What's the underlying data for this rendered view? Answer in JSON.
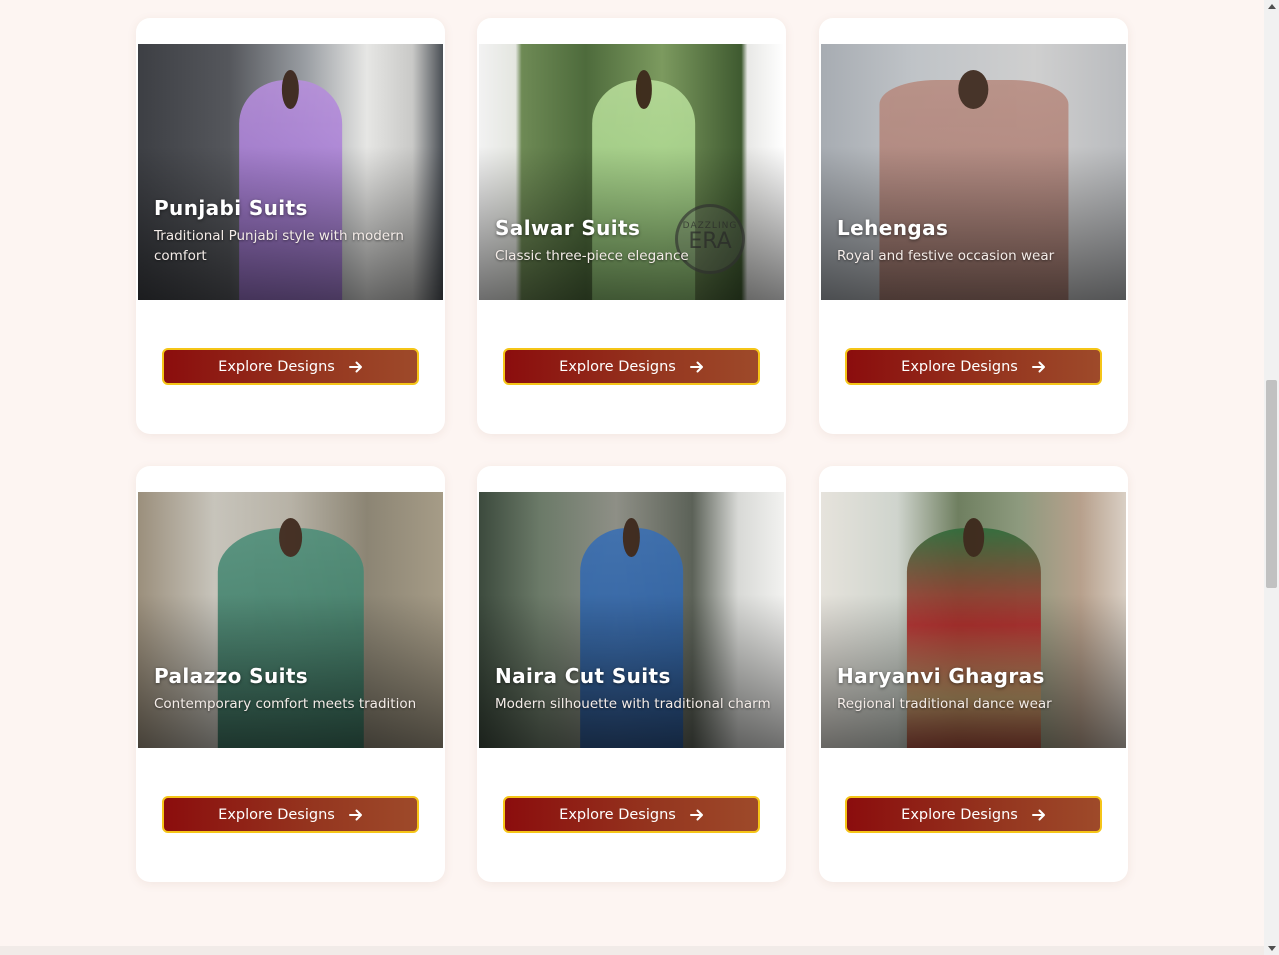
{
  "categories": [
    {
      "title": "Punjabi Suits",
      "description": "Traditional Punjabi style with modern comfort",
      "button_label": "Explore Designs"
    },
    {
      "title": "Salwar Suits",
      "description": "Classic three-piece elegance",
      "button_label": "Explore Designs",
      "watermark_top": "DAZZLING",
      "watermark_bottom": "ERA"
    },
    {
      "title": "Lehengas",
      "description": "Royal and festive occasion wear",
      "button_label": "Explore Designs"
    },
    {
      "title": "Palazzo Suits",
      "description": "Contemporary comfort meets tradition",
      "button_label": "Explore Designs"
    },
    {
      "title": "Naira Cut Suits",
      "description": "Modern silhouette with traditional charm",
      "button_label": "Explore Designs"
    },
    {
      "title": "Haryanvi Ghagras",
      "description": "Regional traditional dance wear",
      "button_label": "Explore Designs"
    }
  ],
  "theme": {
    "page_background": "#fdf5f2",
    "button_gradient_start": "#8b0d0d",
    "button_gradient_end": "#9e4a2a",
    "button_border": "#f5c518"
  },
  "icons": {
    "button_icon": "arrow-right-icon"
  }
}
